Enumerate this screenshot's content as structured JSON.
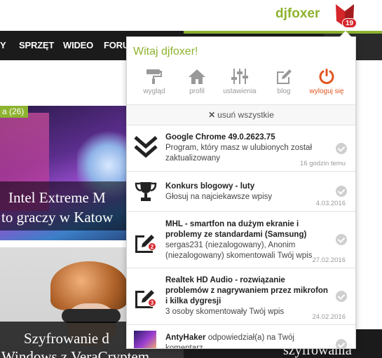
{
  "header": {
    "username": "djfoxer",
    "notification_count": "19"
  },
  "nav": {
    "items": [
      "Y",
      "SPRZĘT",
      "WIDEO",
      "FORU"
    ]
  },
  "background": {
    "count_badge": "a (26)",
    "articles": [
      {
        "title_line1": "Intel Extreme M",
        "title_line2": "to graczy w Katow"
      },
      {
        "title_line1": "Szyfrowanie d",
        "title_line2": "Windows z VeraCryptem"
      }
    ],
    "right_snippet": "szyfrowania"
  },
  "panel": {
    "welcome": "Witaj djfoxer!",
    "actions": [
      {
        "label": "wygląd",
        "icon": "paint-roller-icon"
      },
      {
        "label": "profil",
        "icon": "home-icon"
      },
      {
        "label": "ustawienia",
        "icon": "sliders-icon"
      },
      {
        "label": "blog",
        "icon": "edit-icon"
      },
      {
        "label": "wyloguj się",
        "icon": "power-icon"
      }
    ],
    "remove_all": "usuń wszystkie",
    "notifications": [
      {
        "title": "Google Chrome 49.0.2623.75",
        "body": "Program, który masz w ulubionych został zaktualizowany",
        "date": "16 godzin temu",
        "icon": "double-chevron-down-icon"
      },
      {
        "title": "Konkurs blogowy - luty",
        "body": "Głosuj na najciekawsze wpisy",
        "date": "4.03.2016",
        "icon": "trophy-icon"
      },
      {
        "title": "MHL - smartfon na dużym ekranie i problemy ze standardami (Samsung)",
        "body": "sergas231 (niezalogowany), Anonim (niezalogowany) skomentowali Twój wpis",
        "date": "27.02.2016",
        "icon": "comment-edit-icon",
        "badge": "2"
      },
      {
        "title": "Realtek HD Audio - rozwiązanie problemów z nagrywaniem przez mikrofon i kilka dygresji",
        "body": "3 osoby skomentowały Twój wpis",
        "date": "24.02.2016",
        "icon": "comment-edit-icon",
        "badge": "3"
      },
      {
        "title": "AntyHaker",
        "body": "odpowiedział(a) na Twój komentarz",
        "date": "",
        "icon": "avatar"
      }
    ]
  },
  "colors": {
    "accent": "#8db32f",
    "logout": "#e0551f",
    "badge": "#d5262b",
    "nav_bg": "#1b1b1b"
  }
}
